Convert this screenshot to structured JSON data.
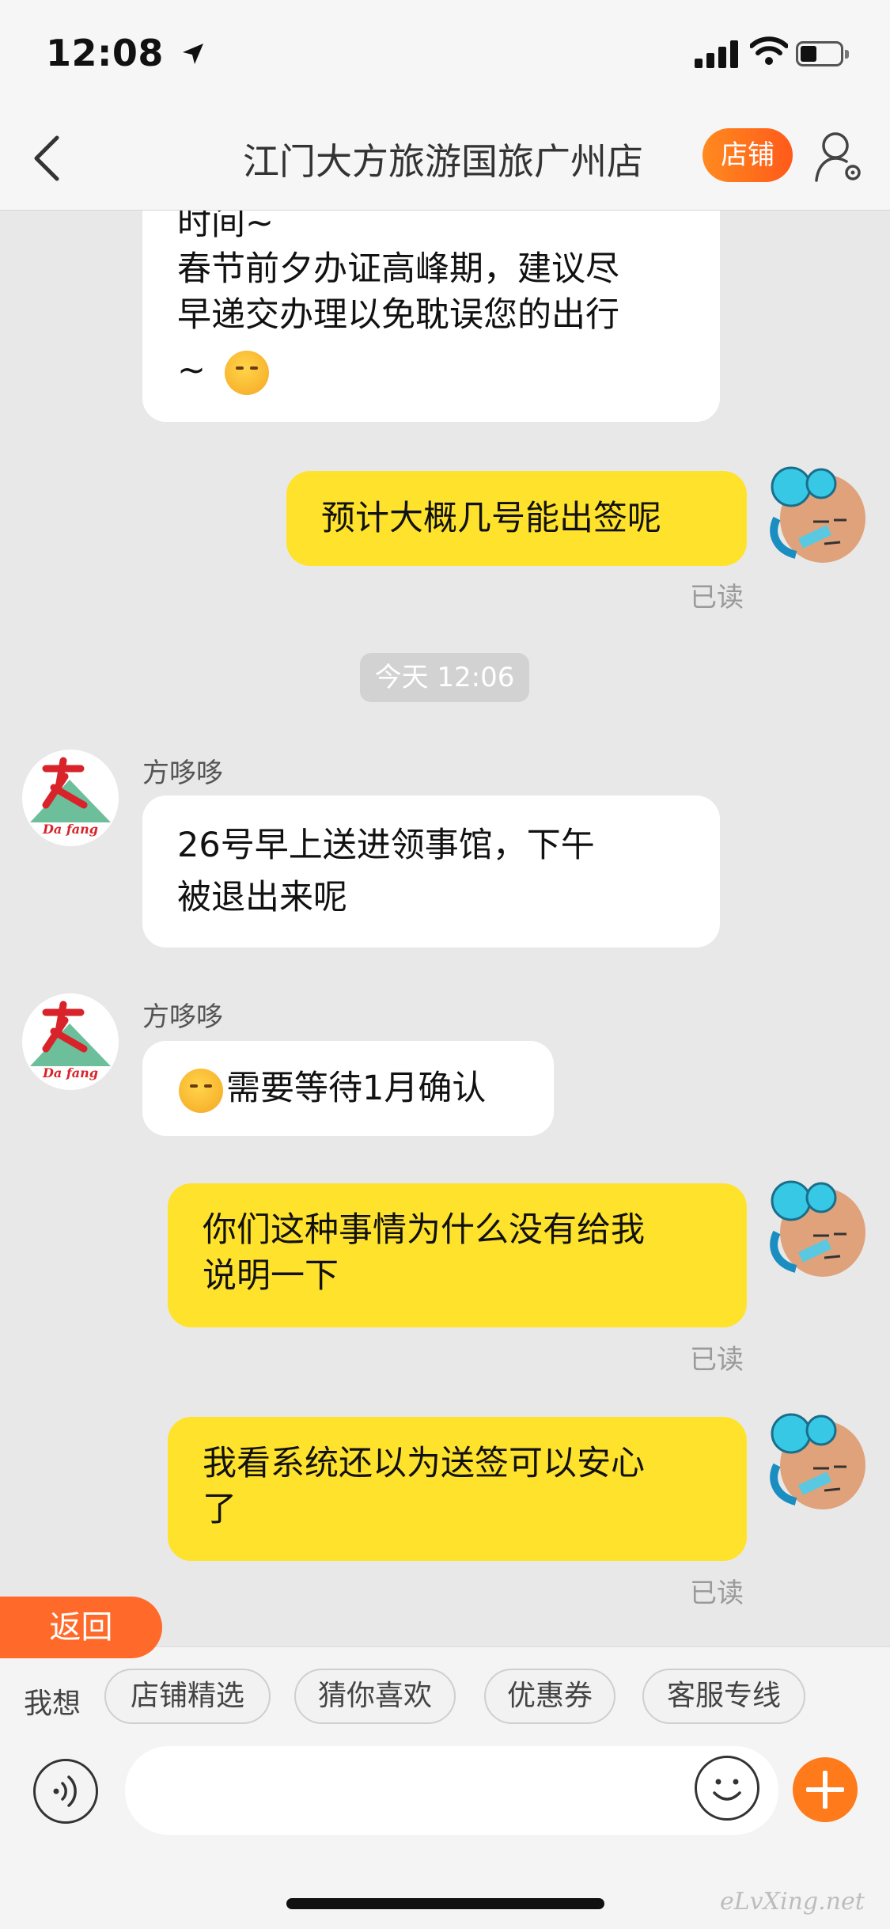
{
  "status_bar": {
    "time": "12:08"
  },
  "nav": {
    "title": "江门大方旅游国旅广州店",
    "shop_button": "店铺"
  },
  "messages": {
    "m1_line1": "时间~",
    "m1_line2": "春节前夕办证高峰期，建议尽",
    "m1_line3": "早递交办理以免耽误您的出行",
    "m1_line4": "~",
    "m2": "预计大概几号能出签呢",
    "m2_read": "已读",
    "timestamp": "今天 12:06",
    "sender_name": "方哆哆",
    "m3_line1": "26号早上送进领事馆，下午",
    "m3_line2": "被退出来呢",
    "sender_name_2": "方哆哆",
    "m4": "需要等待1月确认",
    "m5_line1": "你们这种事情为什么没有给我",
    "m5_line2": "说明一下",
    "m5_read": "已读",
    "m6_line1": "我看系统还以为送签可以安心",
    "m6_line2": "了",
    "m6_read": "已读"
  },
  "return_button": "返回",
  "quick": {
    "label": "我想",
    "chips": [
      "店铺精选",
      "猜你喜欢",
      "优惠券",
      "客服专线"
    ]
  },
  "input": {
    "placeholder": ""
  },
  "shop_logo_text": "Da fang",
  "watermark": "eLvXing.net",
  "colors": {
    "accent": "#ff6a2a",
    "my_bubble": "#ffe22b",
    "their_bubble": "#ffffff",
    "chat_bg": "#e8e8e8"
  },
  "icons": [
    "location-arrow-icon",
    "signal-icon",
    "wifi-icon",
    "battery-icon",
    "back-chevron-icon",
    "user-settings-icon",
    "voice-icon",
    "emoji-icon",
    "plus-icon"
  ]
}
